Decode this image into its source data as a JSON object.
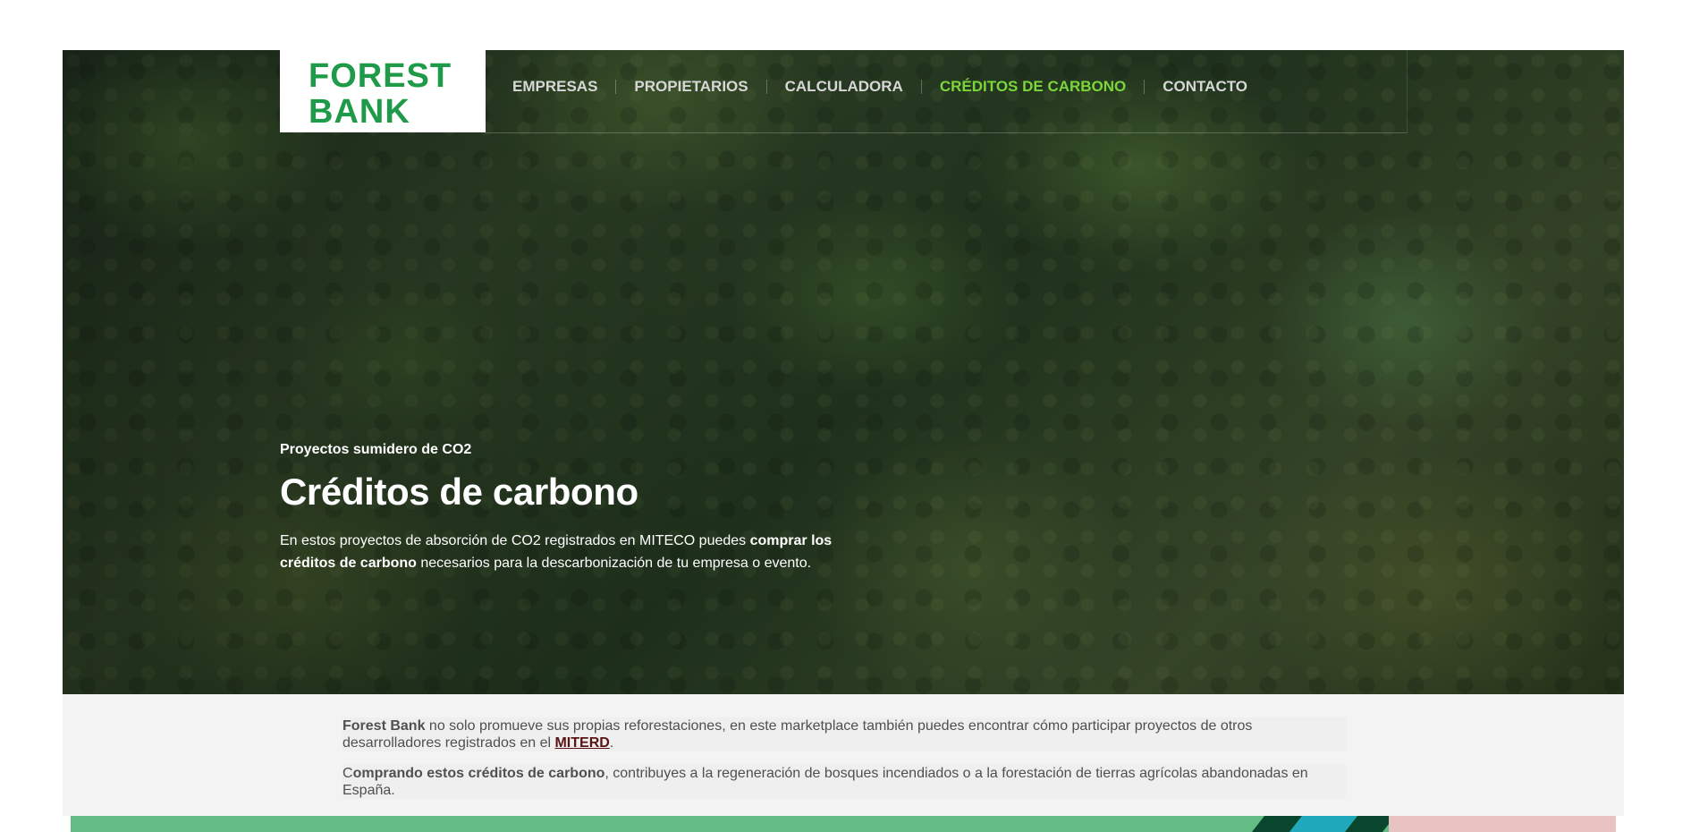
{
  "brand": {
    "line1": "FOREST",
    "line2": "BANK"
  },
  "nav": {
    "items": [
      {
        "label": "EMPRESAS",
        "active": false
      },
      {
        "label": "PROPIETARIOS",
        "active": false
      },
      {
        "label": "CALCULADORA",
        "active": false
      },
      {
        "label": "CRÉDITOS DE CARBONO",
        "active": true
      },
      {
        "label": "CONTACTO",
        "active": false
      }
    ]
  },
  "hero": {
    "eyebrow": "Proyectos sumidero de CO2",
    "title": "Créditos de carbono",
    "text_prefix": "En estos proyectos de absorción de CO2 registrados en MITECO puedes ",
    "text_strong": "comprar los créditos de carbono",
    "text_suffix": " necesarios para la descarbonización de tu empresa o evento."
  },
  "info": {
    "paragraph1": {
      "strong_brand": "Forest Bank",
      "text_before_link": " no solo promueve sus propias reforestaciones, en este marketplace también puedes encontrar cómo participar proyectos de otros desarrolladores registrados en el ",
      "link": "MITERD",
      "text_after_link": "."
    },
    "paragraph2": {
      "text_prefix": "C",
      "strong": "omprando estos créditos de carbono",
      "text_suffix": ", contribuyes a la regeneración de bosques incendiados o a la forestación de tierras agrícolas abandonadas en España."
    }
  },
  "colors": {
    "brand_green": "#1f9a49",
    "active_nav": "#7bd63b",
    "link": "#5b1414"
  }
}
